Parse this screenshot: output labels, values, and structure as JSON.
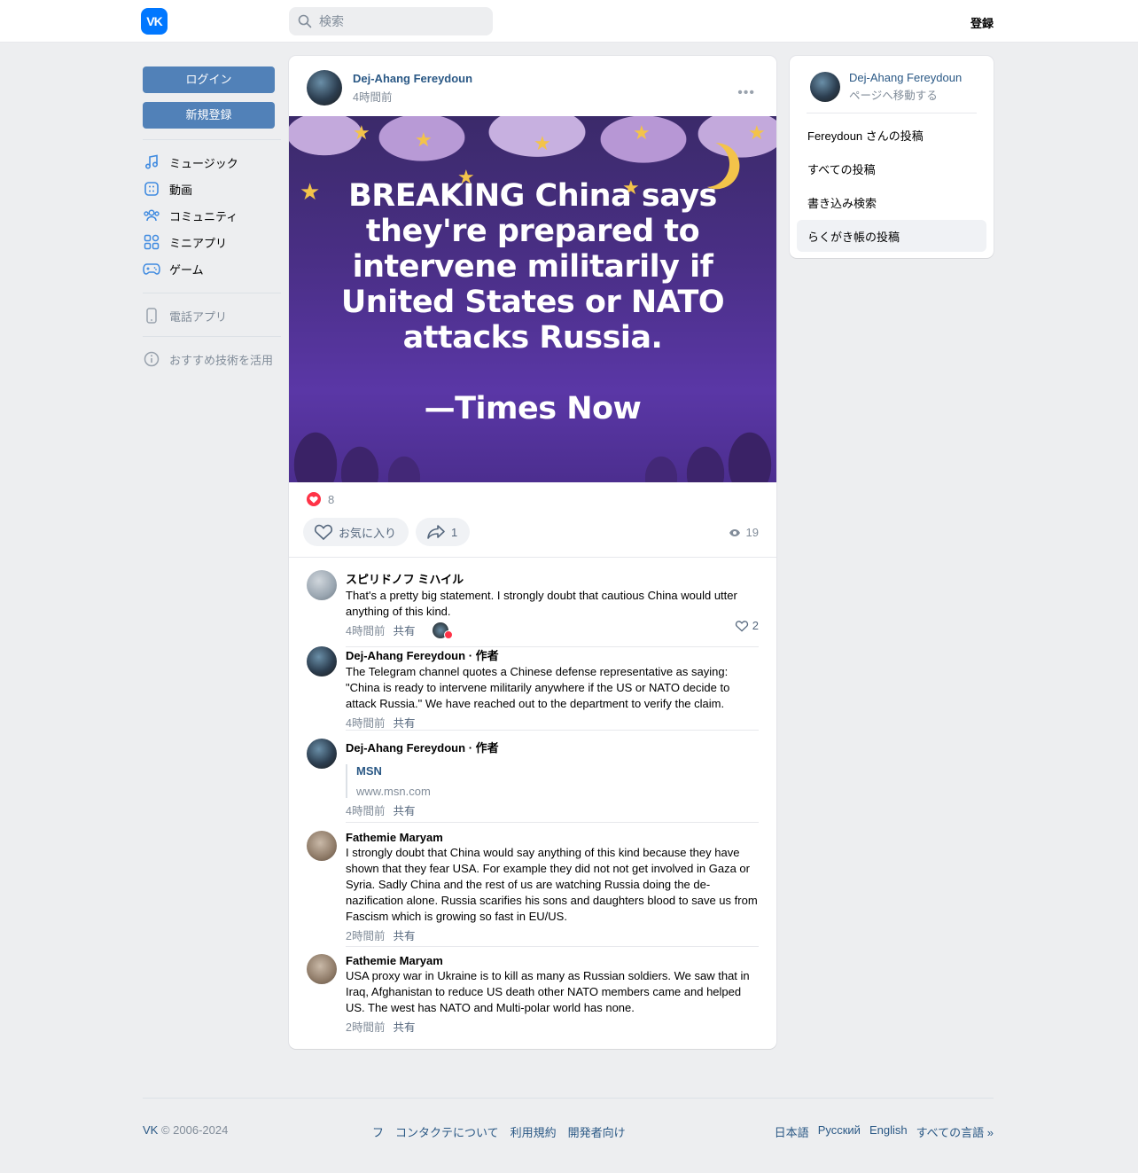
{
  "header": {
    "logo_text": "VK",
    "search_placeholder": "検索",
    "register_label": "登録"
  },
  "left_sidebar": {
    "login_label": "ログイン",
    "signup_label": "新規登録",
    "nav": [
      {
        "label": "ミュージック",
        "icon": "music-note-icon"
      },
      {
        "label": "動画",
        "icon": "video-icon"
      },
      {
        "label": "コミュニティ",
        "icon": "community-icon"
      },
      {
        "label": "ミニアプリ",
        "icon": "mini-apps-icon"
      },
      {
        "label": "ゲーム",
        "icon": "gamepad-icon"
      }
    ],
    "phone_app_label": "電話アプリ",
    "recommend_label": "おすすめ技術を活用"
  },
  "post": {
    "author": "Dej-Ahang Fereydoun",
    "time": "4時間前",
    "image_text": "BREAKING China says they're prepared to intervene militarily if United States or NATO attacks Russia.",
    "image_source": "—Times Now",
    "likes_count": "8",
    "like_button_label": "お気に入り",
    "share_count": "1",
    "views_count": "19"
  },
  "comments": [
    {
      "author": "スピリドノフ ミハイル",
      "author_tag": "",
      "text": "That's a pretty big statement. I strongly doubt that cautious China would utter anything of this kind.",
      "time": "4時間前",
      "share": "共有",
      "likes": "2"
    },
    {
      "author": "Dej-Ahang Fereydoun",
      "author_tag": "· 作者",
      "text": "The Telegram channel quotes a Chinese defense representative as saying: \"China is ready to intervene militarily anywhere if the US or NATO decide to attack Russia.\" We have reached out to the department to verify the claim.",
      "time": "4時間前",
      "share": "共有"
    },
    {
      "author": "Dej-Ahang Fereydoun",
      "author_tag": "· 作者",
      "link_title": "MSN",
      "link_url": "www.msn.com",
      "time": "4時間前",
      "share": "共有"
    },
    {
      "author": "Fathemie Maryam",
      "author_tag": "",
      "text": "I strongly doubt that China would say anything of this kind because they have shown that they fear USA. For example they did not not get involved in Gaza or Syria. Sadly China and the rest of us are watching Russia doing the de-nazification alone. Russia scarifies his sons and daughters blood to save us from Fascism which is growing so fast in EU/US.",
      "time": "2時間前",
      "share": "共有"
    },
    {
      "author": "Fathemie Maryam",
      "author_tag": "",
      "text": "USA proxy war in Ukraine is to kill as many as Russian soldiers. We saw that in Iraq, Afghanistan to reduce US death other NATO members came and helped US. The west has NATO and Multi-polar world has none.",
      "time": "2時間前",
      "share": "共有"
    }
  ],
  "right_sidebar": {
    "name": "Dej-Ahang Fereydoun",
    "goto_label": "ページへ移動する",
    "menu": [
      "Fereydoun さんの投稿",
      "すべての投稿",
      "書き込み検索",
      "らくがき帳の投稿"
    ]
  },
  "footer": {
    "copyright_brand": "VK",
    "copyright": "© 2006-2024",
    "links": [
      "フ",
      "コンタクテについて",
      "利用規約",
      "開発者向け"
    ],
    "languages": [
      "日本語",
      "Русский",
      "English",
      "すべての言語 »"
    ]
  },
  "colors": {
    "accent": "#0077ff",
    "button_blue": "#5181b8",
    "link": "#2a5885",
    "like_red": "#ff3347",
    "page_bg": "#edeef0"
  }
}
